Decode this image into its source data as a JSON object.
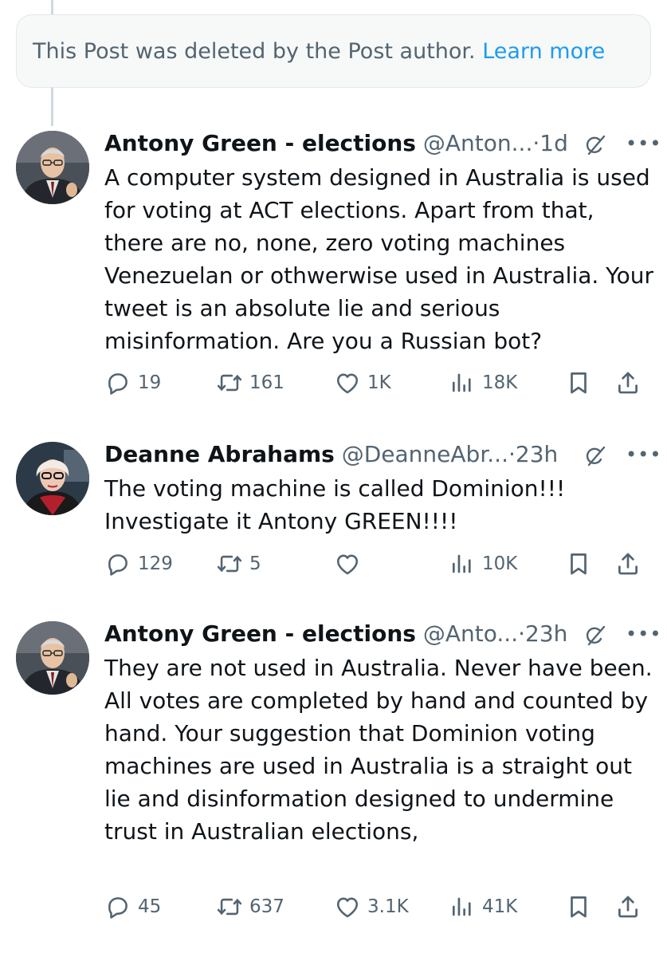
{
  "deleted_notice": {
    "text": "This Post was deleted by the Post author.",
    "link": "Learn more"
  },
  "tweets": [
    {
      "name": "Antony Green - elections",
      "handle": "@Anton...",
      "time": "1d",
      "text": "A computer system designed in Australia is used for voting at ACT elections. Apart from that, there are no, none, zero voting machines Venezuelan or othwerwise used in Australia. Your tweet is an absolute lie and serious misinformation. Are you a Russian bot?",
      "replies": "19",
      "reposts": "161",
      "likes": "1K",
      "views": "18K"
    },
    {
      "name": "Deanne Abrahams",
      "handle": "@DeanneAbr...",
      "time": "23h",
      "text": "The voting machine is called Dominion!!! Investigate it Antony GREEN!!!!",
      "replies": "129",
      "reposts": "5",
      "likes": "",
      "views": "10K"
    },
    {
      "name": "Antony Green - elections",
      "handle": "@Anto...",
      "time": "23h",
      "text": "They are not used in Australia. Never have been. All votes are completed by hand and counted by hand. Your suggestion that Dominion voting machines are used in Australia is a straight out lie and disinformation designed to undermine trust in Australian elections,",
      "replies": "45",
      "reposts": "637",
      "likes": "3.1K",
      "views": "41K"
    }
  ],
  "icons": {
    "reply": "reply-icon",
    "repost": "repost-icon",
    "like": "heart-icon",
    "views": "views-icon",
    "bookmark": "bookmark-icon",
    "share": "share-icon",
    "grok": "grok-icon",
    "more": "more-icon"
  },
  "colors": {
    "text": "#0f1419",
    "secondary": "#536471",
    "link": "#1d9bf0",
    "thread_line": "#cfd9de"
  }
}
